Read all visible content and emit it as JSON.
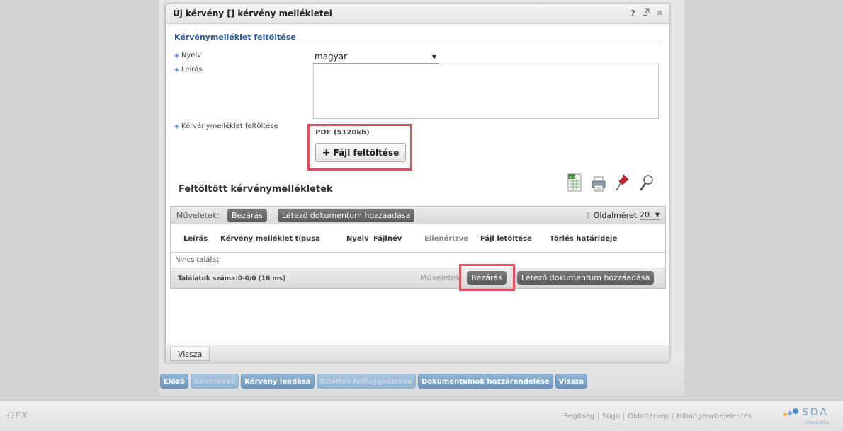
{
  "dialog": {
    "title": "Új kérvény [] kérvény mellékletei",
    "help_icon": "question-icon",
    "popout_icon": "popout-icon",
    "close_icon": "close-icon"
  },
  "section": {
    "title": "Kérvénymelléklet feltöltése"
  },
  "form": {
    "language_label": "Nyelv",
    "language_value": "magyar",
    "description_label": "Leírás",
    "upload_label": "Kérvénymelléklet feltöltése",
    "upload_hint": "PDF (5120kb)",
    "upload_button": "Fájl feltöltése"
  },
  "uploaded": {
    "title": "Feltöltött kérvénymellékletek",
    "tools": [
      "excel-export-icon",
      "print-icon",
      "pin-icon",
      "search-icon"
    ]
  },
  "grid": {
    "actions_label": "Műveletek:",
    "close_button": "Bezárás",
    "add_existing_button": "Létező dokumentum hozzáadása",
    "page_number": "1",
    "page_size_label": "Oldalméret",
    "page_size_value": "20",
    "columns": [
      "Leírás",
      "Kérvény melléklet típusa",
      "Nyelv",
      "Fájlnév",
      "Ellenőrizve",
      "Fájl letöltése",
      "Törlés határideje"
    ],
    "empty_text": "Nincs találat",
    "count_text": "Találatok száma:0-0/0 (16 ms)",
    "footer_actions_label": "Műveletek",
    "footer_close_button": "Bezárás",
    "footer_add_existing_button": "Létező dokumentum hozzáadása"
  },
  "dialog_footer": {
    "back_button": "Vissza"
  },
  "bottom_buttons": [
    {
      "label": "Előző",
      "disabled": false
    },
    {
      "label": "Következő",
      "disabled": true
    },
    {
      "label": "Kérvény leadása",
      "disabled": false
    },
    {
      "label": "Kitöltés felfüggesztése",
      "disabled": true
    },
    {
      "label": "Dokumentumok hozzárendelése",
      "disabled": false
    },
    {
      "label": "Vissza",
      "disabled": false
    }
  ],
  "footer": {
    "logo_text": "ΩFX",
    "links": [
      "Segítség",
      "Súgó",
      "Oldaltérkép",
      "Hiba/Igénybejelentés"
    ],
    "brand": "SDA",
    "brand_sub": "Informatika"
  },
  "colors": {
    "highlight": "#e0505f",
    "section_title": "#2a5b9a",
    "bottom_button": "#7aa3c9"
  }
}
